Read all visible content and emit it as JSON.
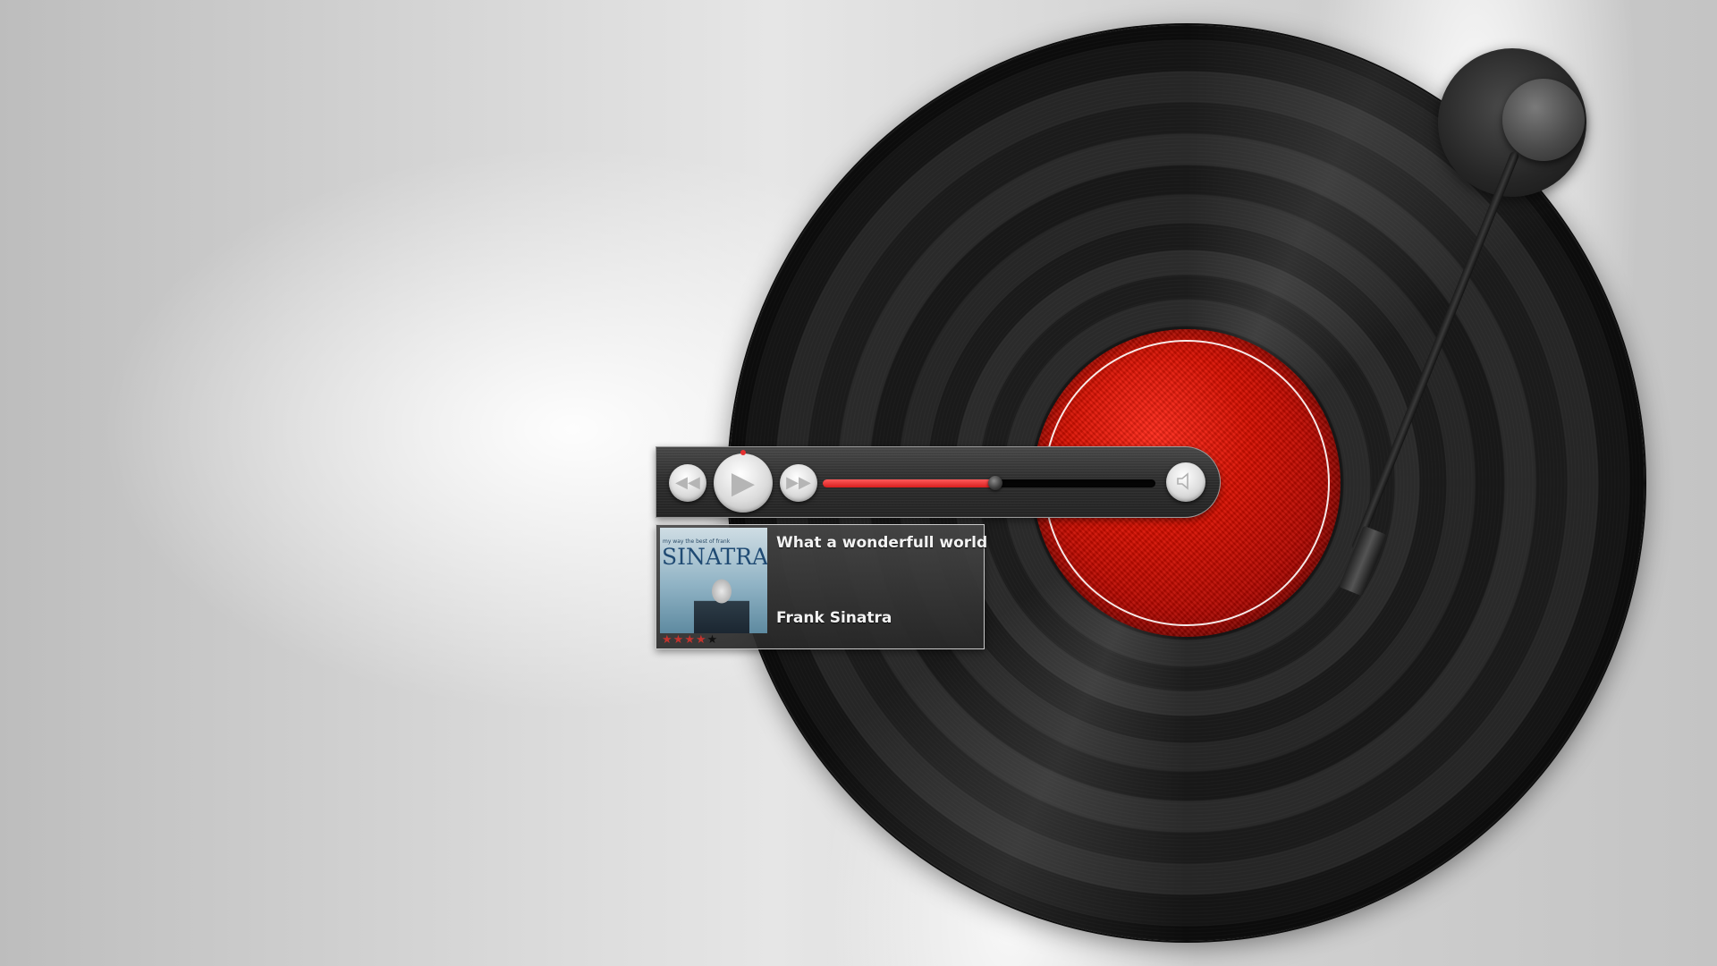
{
  "player": {
    "progress_fraction": 0.52,
    "accent_color": "#d61e1e",
    "controls": {
      "rewind_icon": "rewind-icon",
      "play_icon": "play-icon",
      "forward_icon": "fast-forward-icon",
      "volume_icon": "speaker-icon"
    }
  },
  "track": {
    "title": "What a wonderfull world",
    "artist": "Frank Sinatra",
    "rating": 4,
    "rating_max": 5,
    "cover": {
      "top_text": "my way the best of frank",
      "name": "SINATRA"
    }
  },
  "turntable": {
    "label_color": "#c8140a"
  }
}
